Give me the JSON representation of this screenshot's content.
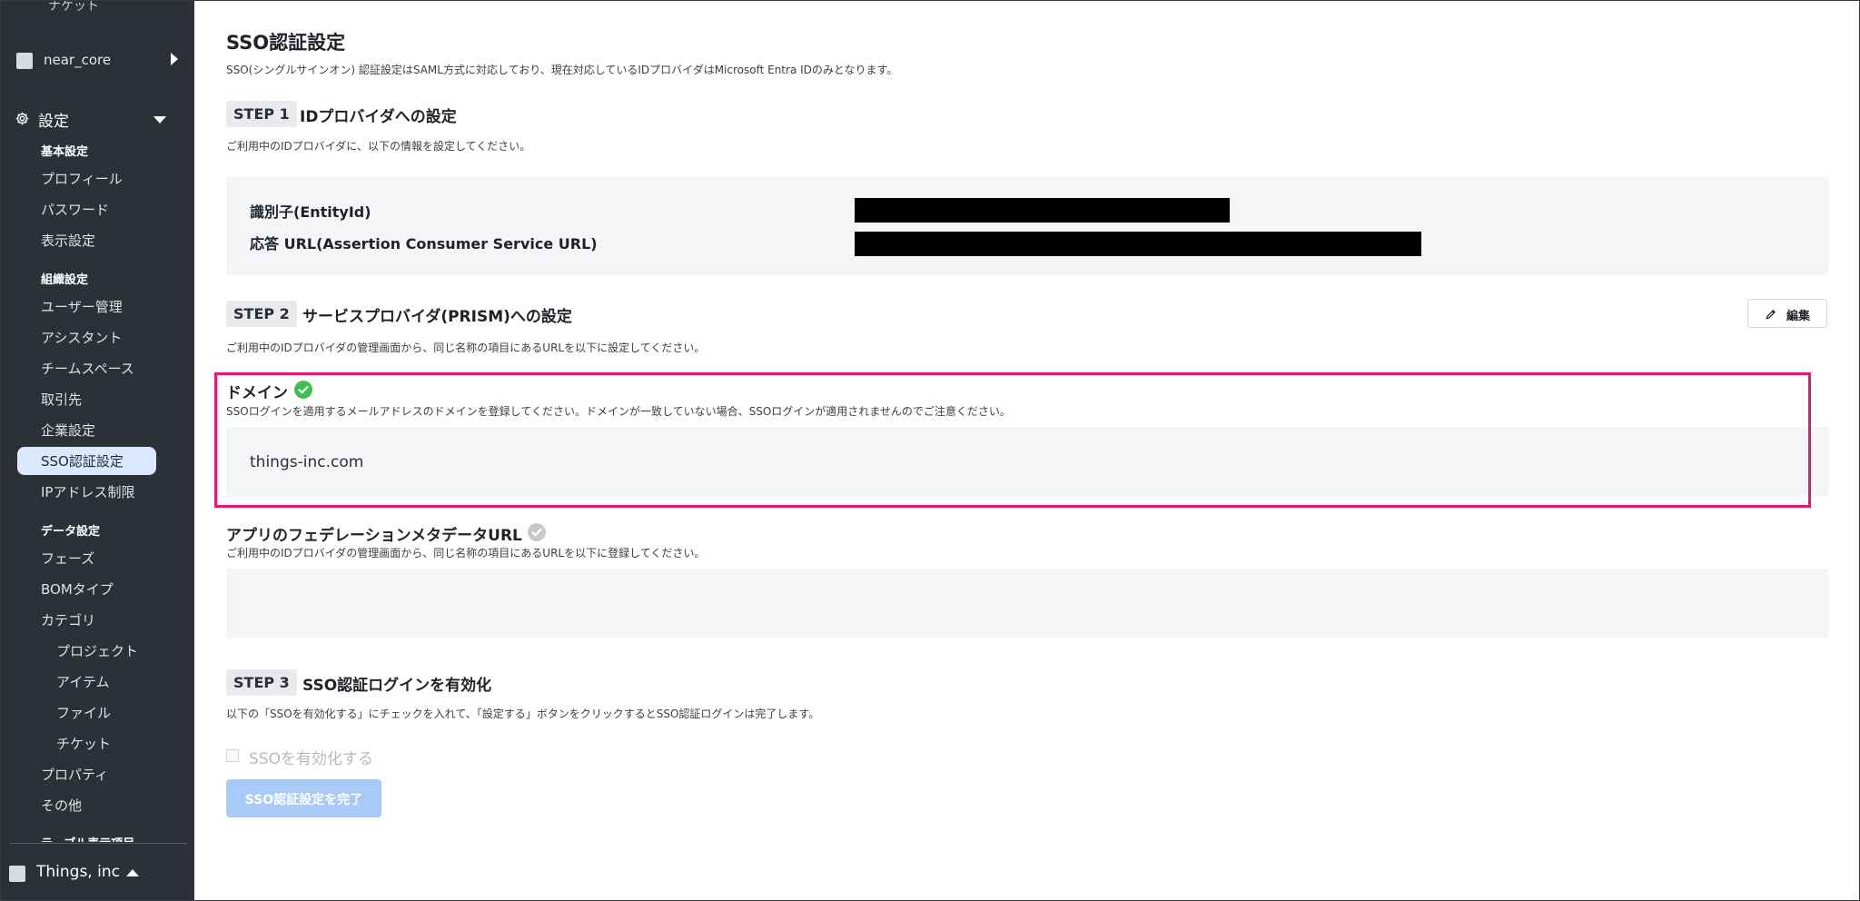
{
  "sidebar": {
    "top_item": "ナケット",
    "project": "near_core",
    "settings_label": "設定",
    "sections": {
      "basic": "基本設定",
      "org": "組織設定",
      "data": "データ設定",
      "table": "テーブル表示項目"
    },
    "basic_items": [
      "プロフィール",
      "パスワード",
      "表示設定"
    ],
    "org_items": [
      "ユーザー管理",
      "アシスタント",
      "チームスペース",
      "取引先",
      "企業設定",
      "SSO認証設定",
      "IPアドレス制限"
    ],
    "data_items": {
      "phase": "フェーズ",
      "bom": "BOMタイプ",
      "category": "カテゴリ",
      "category_sub": [
        "プロジェクト",
        "アイテム",
        "ファイル",
        "チケット"
      ],
      "property": "プロパティ",
      "other": "その他"
    },
    "org_name": "Things, inc"
  },
  "page": {
    "title": "SSO認証設定",
    "description": "SSO(シングルサインオン) 認証設定はSAML方式に対応しており、現在対応しているIDプロバイダはMicrosoft Entra IDのみとなります。"
  },
  "step1": {
    "tag": "STEP 1",
    "title": "IDプロバイダへの設定",
    "description": "ご利用中のIDプロバイダに、以下の情報を設定してください。",
    "entity_label": "識別子(EntityId)",
    "acs_label": "応答 URL(Assertion Consumer Service URL)"
  },
  "step2": {
    "tag": "STEP 2",
    "title": "サービスプロバイダ(PRISM)への設定",
    "description": "ご利用中のIDプロバイダの管理画面から、同じ名称の項目にあるURLを以下に設定してください。",
    "edit_label": "編集",
    "domain": {
      "title": "ドメイン",
      "description": "SSOログインを適用するメールアドレスのドメインを登録してください。ドメインが一致していない場合、SSOログインが適用されませんのでご注意ください。",
      "value": "things-inc.com"
    },
    "metadata": {
      "title": "アプリのフェデレーションメタデータURL",
      "description": "ご利用中のIDプロバイダの管理画面から、同じ名称の項目にあるURLを以下に登録してください。"
    }
  },
  "step3": {
    "tag": "STEP 3",
    "title": "SSO認証ログインを有効化",
    "description": "以下の「SSOを有効化する」にチェックを入れて、「設定する」ボタンをクリックするとSSO認証ログインは完了します。",
    "checkbox_label": "SSOを有効化する",
    "submit_label": "SSO認証設定を完了"
  },
  "colors": {
    "sidebar_bg": "#2c3138",
    "active_item_bg": "#dbe8ff",
    "highlight_border": "#e8196c",
    "check_green": "#3fbf4f",
    "check_gray": "#c5c8cc",
    "submit_disabled": "#a9caf6"
  }
}
